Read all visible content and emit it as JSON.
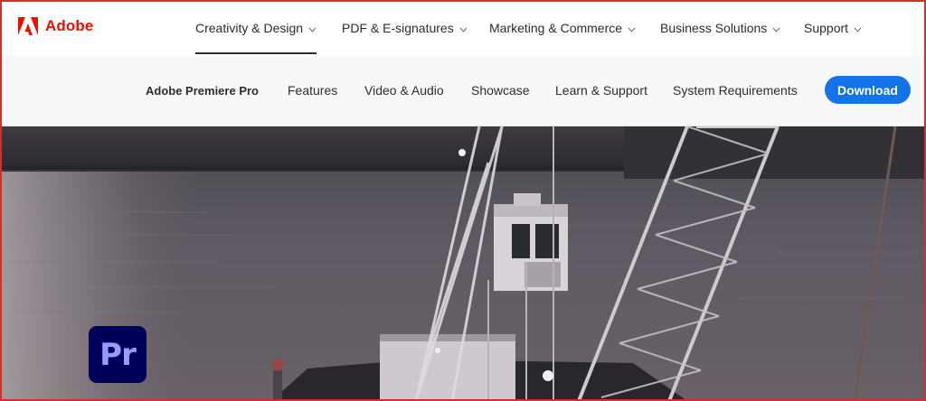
{
  "brand": {
    "name": "Adobe",
    "logo_icon": "adobe-logo-icon",
    "color": "#eb1000"
  },
  "global_nav": {
    "items": [
      {
        "label": "Creativity & Design",
        "active": true
      },
      {
        "label": "PDF & E-signatures",
        "active": false
      },
      {
        "label": "Marketing & Commerce",
        "active": false
      },
      {
        "label": "Business Solutions",
        "active": false
      },
      {
        "label": "Support",
        "active": false
      }
    ],
    "chevron_icon": "chevron-down-icon"
  },
  "local_nav": {
    "product": "Adobe Premiere Pro",
    "items": [
      {
        "label": "Features"
      },
      {
        "label": "Video & Audio"
      },
      {
        "label": "Showcase"
      },
      {
        "label": "Learn & Support"
      },
      {
        "label": "System Requirements"
      }
    ],
    "cta": {
      "label": "Download",
      "color": "#1473e6"
    }
  },
  "hero": {
    "image": "harbor-crane-ship-photo",
    "product_badge": {
      "text": "Pr",
      "icon": "premiere-pro-app-icon",
      "bg": "#00005b",
      "fg": "#9999ff"
    }
  }
}
